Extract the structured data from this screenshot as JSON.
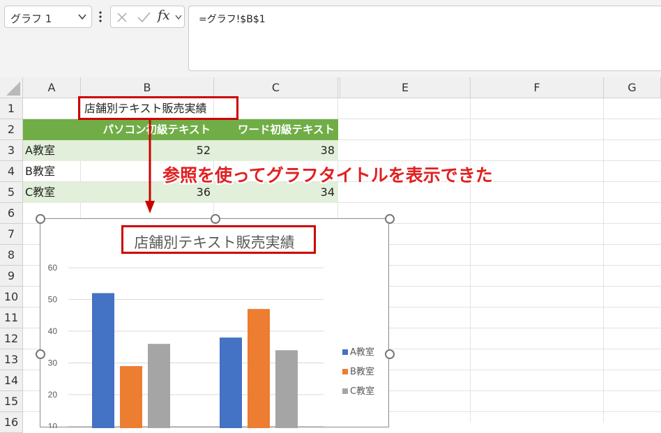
{
  "formula_bar": {
    "name_box_value": "グラフ 1",
    "fx_label": "fx",
    "formula": "=グラフ!$B$1"
  },
  "columns": [
    "A",
    "B",
    "C",
    "E",
    "F",
    "G"
  ],
  "rows": [
    "1",
    "2",
    "3",
    "4",
    "5",
    "6",
    "7",
    "8",
    "9",
    "10",
    "11",
    "12",
    "13",
    "14",
    "15",
    "16"
  ],
  "sheet": {
    "b1": "店舗別テキスト販売実績",
    "header_b": "パソコン初級テキスト",
    "header_c": "ワード初級テキスト",
    "data": [
      {
        "label": "A教室",
        "b": "52",
        "c": "38"
      },
      {
        "label": "B教室",
        "b": "",
        "c": ""
      },
      {
        "label": "C教室",
        "b": "36",
        "c": "34"
      }
    ]
  },
  "annotation": {
    "callout_text": "参照を使ってグラフタイトルを表示できた",
    "accent_color": "#cc0000"
  },
  "chart_data": {
    "type": "bar",
    "title": "店舗別テキスト販売実績",
    "categories": [
      "パソコン初級テキスト",
      "ワード初級テキスト"
    ],
    "series": [
      {
        "name": "A教室",
        "values": [
          52,
          38
        ],
        "color": "#4472c4"
      },
      {
        "name": "B教室",
        "values": [
          29,
          47
        ],
        "color": "#ed7d31"
      },
      {
        "name": "C教室",
        "values": [
          36,
          34
        ],
        "color": "#a5a5a5"
      }
    ],
    "yticks": [
      "60",
      "50",
      "40",
      "30",
      "20",
      "10"
    ],
    "ylim": [
      0,
      60
    ],
    "grid": true,
    "legend_position": "right"
  }
}
